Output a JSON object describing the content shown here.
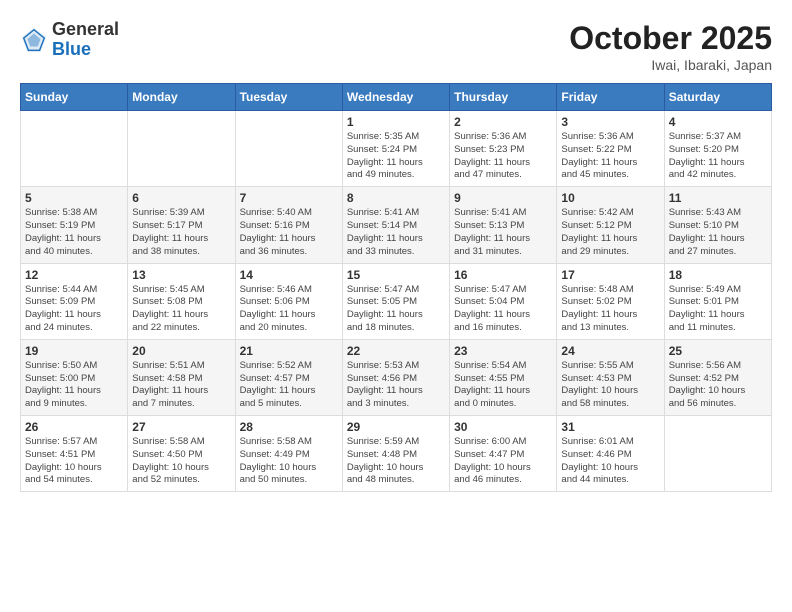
{
  "header": {
    "logo_general": "General",
    "logo_blue": "Blue",
    "month": "October 2025",
    "location": "Iwai, Ibaraki, Japan"
  },
  "days_of_week": [
    "Sunday",
    "Monday",
    "Tuesday",
    "Wednesday",
    "Thursday",
    "Friday",
    "Saturday"
  ],
  "weeks": [
    [
      {
        "day": null,
        "info": null
      },
      {
        "day": null,
        "info": null
      },
      {
        "day": null,
        "info": null
      },
      {
        "day": "1",
        "info": "Sunrise: 5:35 AM\nSunset: 5:24 PM\nDaylight: 11 hours\nand 49 minutes."
      },
      {
        "day": "2",
        "info": "Sunrise: 5:36 AM\nSunset: 5:23 PM\nDaylight: 11 hours\nand 47 minutes."
      },
      {
        "day": "3",
        "info": "Sunrise: 5:36 AM\nSunset: 5:22 PM\nDaylight: 11 hours\nand 45 minutes."
      },
      {
        "day": "4",
        "info": "Sunrise: 5:37 AM\nSunset: 5:20 PM\nDaylight: 11 hours\nand 42 minutes."
      }
    ],
    [
      {
        "day": "5",
        "info": "Sunrise: 5:38 AM\nSunset: 5:19 PM\nDaylight: 11 hours\nand 40 minutes."
      },
      {
        "day": "6",
        "info": "Sunrise: 5:39 AM\nSunset: 5:17 PM\nDaylight: 11 hours\nand 38 minutes."
      },
      {
        "day": "7",
        "info": "Sunrise: 5:40 AM\nSunset: 5:16 PM\nDaylight: 11 hours\nand 36 minutes."
      },
      {
        "day": "8",
        "info": "Sunrise: 5:41 AM\nSunset: 5:14 PM\nDaylight: 11 hours\nand 33 minutes."
      },
      {
        "day": "9",
        "info": "Sunrise: 5:41 AM\nSunset: 5:13 PM\nDaylight: 11 hours\nand 31 minutes."
      },
      {
        "day": "10",
        "info": "Sunrise: 5:42 AM\nSunset: 5:12 PM\nDaylight: 11 hours\nand 29 minutes."
      },
      {
        "day": "11",
        "info": "Sunrise: 5:43 AM\nSunset: 5:10 PM\nDaylight: 11 hours\nand 27 minutes."
      }
    ],
    [
      {
        "day": "12",
        "info": "Sunrise: 5:44 AM\nSunset: 5:09 PM\nDaylight: 11 hours\nand 24 minutes."
      },
      {
        "day": "13",
        "info": "Sunrise: 5:45 AM\nSunset: 5:08 PM\nDaylight: 11 hours\nand 22 minutes."
      },
      {
        "day": "14",
        "info": "Sunrise: 5:46 AM\nSunset: 5:06 PM\nDaylight: 11 hours\nand 20 minutes."
      },
      {
        "day": "15",
        "info": "Sunrise: 5:47 AM\nSunset: 5:05 PM\nDaylight: 11 hours\nand 18 minutes."
      },
      {
        "day": "16",
        "info": "Sunrise: 5:47 AM\nSunset: 5:04 PM\nDaylight: 11 hours\nand 16 minutes."
      },
      {
        "day": "17",
        "info": "Sunrise: 5:48 AM\nSunset: 5:02 PM\nDaylight: 11 hours\nand 13 minutes."
      },
      {
        "day": "18",
        "info": "Sunrise: 5:49 AM\nSunset: 5:01 PM\nDaylight: 11 hours\nand 11 minutes."
      }
    ],
    [
      {
        "day": "19",
        "info": "Sunrise: 5:50 AM\nSunset: 5:00 PM\nDaylight: 11 hours\nand 9 minutes."
      },
      {
        "day": "20",
        "info": "Sunrise: 5:51 AM\nSunset: 4:58 PM\nDaylight: 11 hours\nand 7 minutes."
      },
      {
        "day": "21",
        "info": "Sunrise: 5:52 AM\nSunset: 4:57 PM\nDaylight: 11 hours\nand 5 minutes."
      },
      {
        "day": "22",
        "info": "Sunrise: 5:53 AM\nSunset: 4:56 PM\nDaylight: 11 hours\nand 3 minutes."
      },
      {
        "day": "23",
        "info": "Sunrise: 5:54 AM\nSunset: 4:55 PM\nDaylight: 11 hours\nand 0 minutes."
      },
      {
        "day": "24",
        "info": "Sunrise: 5:55 AM\nSunset: 4:53 PM\nDaylight: 10 hours\nand 58 minutes."
      },
      {
        "day": "25",
        "info": "Sunrise: 5:56 AM\nSunset: 4:52 PM\nDaylight: 10 hours\nand 56 minutes."
      }
    ],
    [
      {
        "day": "26",
        "info": "Sunrise: 5:57 AM\nSunset: 4:51 PM\nDaylight: 10 hours\nand 54 minutes."
      },
      {
        "day": "27",
        "info": "Sunrise: 5:58 AM\nSunset: 4:50 PM\nDaylight: 10 hours\nand 52 minutes."
      },
      {
        "day": "28",
        "info": "Sunrise: 5:58 AM\nSunset: 4:49 PM\nDaylight: 10 hours\nand 50 minutes."
      },
      {
        "day": "29",
        "info": "Sunrise: 5:59 AM\nSunset: 4:48 PM\nDaylight: 10 hours\nand 48 minutes."
      },
      {
        "day": "30",
        "info": "Sunrise: 6:00 AM\nSunset: 4:47 PM\nDaylight: 10 hours\nand 46 minutes."
      },
      {
        "day": "31",
        "info": "Sunrise: 6:01 AM\nSunset: 4:46 PM\nDaylight: 10 hours\nand 44 minutes."
      },
      {
        "day": null,
        "info": null
      }
    ]
  ]
}
